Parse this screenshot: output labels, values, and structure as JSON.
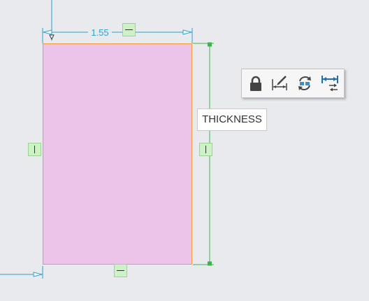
{
  "sketch": {
    "horizontal_dimension": "1.55",
    "tooltip": "THICKNESS"
  },
  "colors": {
    "rectangle_fill": "#ecc4ea",
    "rectangle_edge": "#f39b3a",
    "horizontal_dimension_color": "#2aa3c8",
    "vertical_dimension_color": "#3bb54a",
    "constraint_fill": "#cdf2c5"
  },
  "toolbar": {
    "items": [
      {
        "name": "lock-dimension",
        "icon": "lock-icon"
      },
      {
        "name": "dimension-properties",
        "icon": "dimension-edit-icon"
      },
      {
        "name": "toggle-reference",
        "icon": "swap-reference-icon"
      },
      {
        "name": "flip-dimension",
        "icon": "flip-dimension-icon"
      }
    ]
  }
}
